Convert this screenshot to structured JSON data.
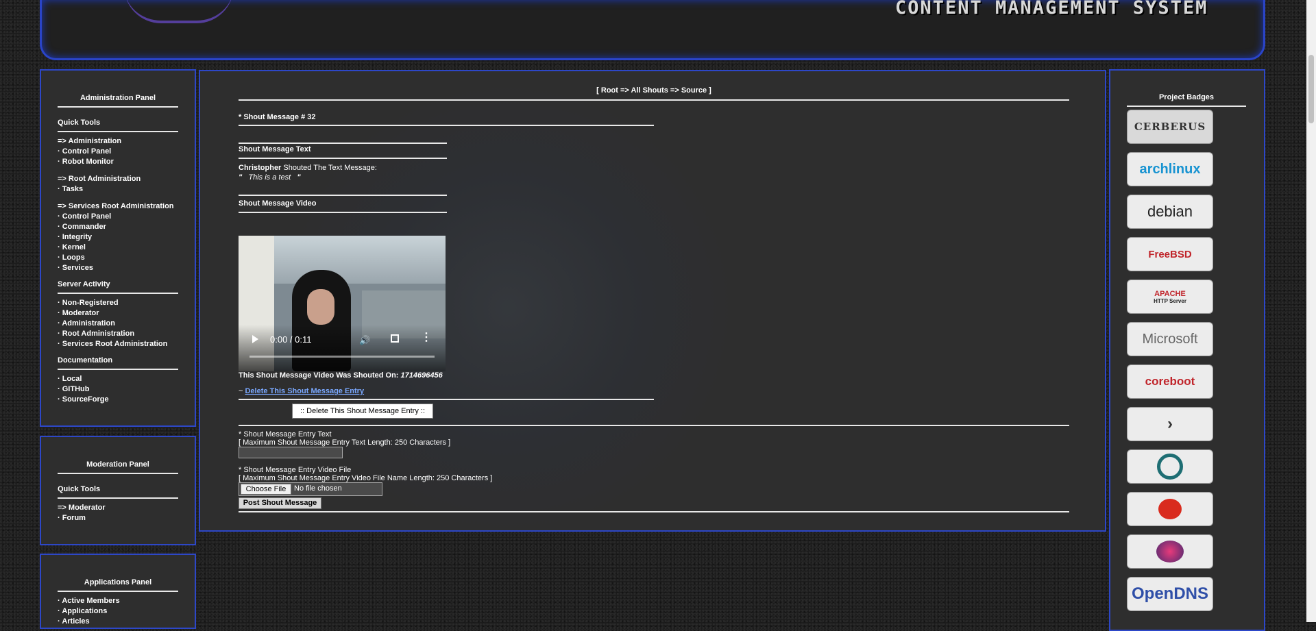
{
  "header": {
    "cms_title": "CONTENT MANAGEMENT SYSTEM"
  },
  "admin_panel": {
    "title": "Administration Panel",
    "quick_tools": "Quick Tools",
    "groups": [
      {
        "head": "Administration",
        "items": [
          "Control Panel",
          "Robot Monitor"
        ]
      },
      {
        "head": "Root Administration",
        "items": [
          "Tasks"
        ]
      },
      {
        "head": "Services Root Administration",
        "items": [
          "Control Panel",
          "Commander",
          "Integrity",
          "Kernel",
          "Loops",
          "Services"
        ]
      }
    ],
    "server_activity": "Server Activity",
    "server_items": [
      "Non-Registered",
      "Moderator",
      "Administration",
      "Root Administration",
      "Services Root Administration"
    ],
    "documentation": "Documentation",
    "doc_items": [
      "Local",
      "GITHub",
      "SourceForge"
    ]
  },
  "moderation_panel": {
    "title": "Moderation Panel",
    "quick_tools": "Quick Tools",
    "head": "Moderator",
    "items": [
      "Forum"
    ]
  },
  "applications_panel": {
    "title": "Applications Panel",
    "items": [
      "Active Members",
      "Applications",
      "Articles"
    ]
  },
  "main": {
    "breadcrumb": "[ Root => All Shouts => Source ]",
    "message_heading": "* Shout Message # 32",
    "text_heading": "Shout Message Text",
    "author": "Christopher",
    "shouted_text": " Shouted The Text Message:",
    "quote_open": "\"",
    "message_text": "This is a test",
    "quote_close": "\"",
    "video_heading": "Shout Message Video",
    "video_time": "0:00 / 0:11",
    "video_shouted_on_label": "This Shout Message Video Was Shouted On: ",
    "video_shouted_on_value": "1714696456",
    "delete_prefix": "~ ",
    "delete_link": "Delete This Shout Message Entry",
    "delete_button": ":: Delete This Shout Message Entry ::",
    "entry_text_label": "* Shout Message Entry Text",
    "entry_text_max": "[ Maximum Shout Message Entry Text Length: 250 Characters ]",
    "entry_video_label": "* Shout Message Entry Video File",
    "entry_video_max": "[ Maximum Shout Message Entry Video File Name Length: 250 Characters ]",
    "choose_file": "Choose File",
    "no_file": "No file chosen",
    "post_button": "Post Shout Message"
  },
  "badges_panel": {
    "title": "Project Badges",
    "badges": [
      "CERBERUS",
      "archlinux",
      "debian",
      "FreeBSD",
      "APACHE",
      "HTTP Server",
      "Microsoft",
      "coreboot",
      "OpenDNS"
    ]
  },
  "colors": {
    "panel_border": "#2d47c8",
    "panel_bg": "#2e2e2e",
    "link": "#7aa8ff"
  }
}
